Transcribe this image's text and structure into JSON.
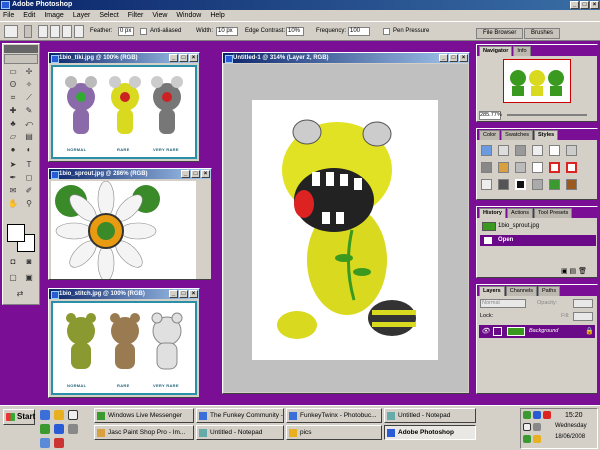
{
  "app": {
    "title": "Adobe Photoshop"
  },
  "menu": [
    "File",
    "Edit",
    "Image",
    "Layer",
    "Select",
    "Filter",
    "View",
    "Window",
    "Help"
  ],
  "options": {
    "feather_label": "Feather:",
    "feather_value": "0 px",
    "anti_aliased_label": "Anti-aliased",
    "width_label": "Width:",
    "width_value": "10 px",
    "edge_contrast_label": "Edge Contrast:",
    "edge_contrast_value": "10%",
    "frequency_label": "Frequency:",
    "frequency_value": "100",
    "pen_pressure_label": "Pen Pressure",
    "file_browser_tab": "File Browser",
    "brushes_tab": "Brushes"
  },
  "doc_bio_tiki": {
    "title": "1bio_tiki.jpg @ 100% (RGB)",
    "captions": [
      "NORMAL",
      "RARE",
      "VERY RARE"
    ]
  },
  "doc_bio_sprout": {
    "title": "1bio_sprout.jpg @ 286% (RGB)"
  },
  "doc_bio_stitch": {
    "title": "1bio_stitch.jpg @ 100% (RGB)",
    "captions": [
      "NORMAL",
      "RARE",
      "VERY RARE"
    ]
  },
  "doc_untitled": {
    "title": "Untitled-1 @ 314% (Layer 2, RGB)"
  },
  "navigator": {
    "tabs": [
      "Navigator",
      "Info"
    ],
    "zoom": "285.77%"
  },
  "styles_panel": {
    "tabs": [
      "Color",
      "Swatches",
      "Styles"
    ]
  },
  "history_panel": {
    "tabs": [
      "History",
      "Actions",
      "Tool Presets"
    ],
    "items": [
      "1bio_sprout.jpg",
      "Open"
    ]
  },
  "layers_panel": {
    "tabs": [
      "Layers",
      "Channels",
      "Paths"
    ],
    "blend_mode": "Normal",
    "opacity_label": "Opacity:",
    "lock_label": "Lock:",
    "fill_label": "Fill:",
    "layer_name": "Background"
  },
  "taskbar": {
    "start_label": "Start",
    "buttons": [
      "Windows Live Messenger",
      "The Funkey Community - ...",
      "FunkeyTwinx - Photobuc...",
      "Untitled - Notepad",
      "Jasc Paint Shop Pro - Im...",
      "Untitled - Notepad",
      "pics",
      "Adobe Photoshop"
    ],
    "time": "15:20",
    "day": "Wednesday",
    "date": "18/06/2008"
  },
  "colors": {
    "desktop": "#7a0e94",
    "selected": "#6a0a88",
    "titlebar": "#0a246a",
    "frame": "#2a8fa8"
  }
}
